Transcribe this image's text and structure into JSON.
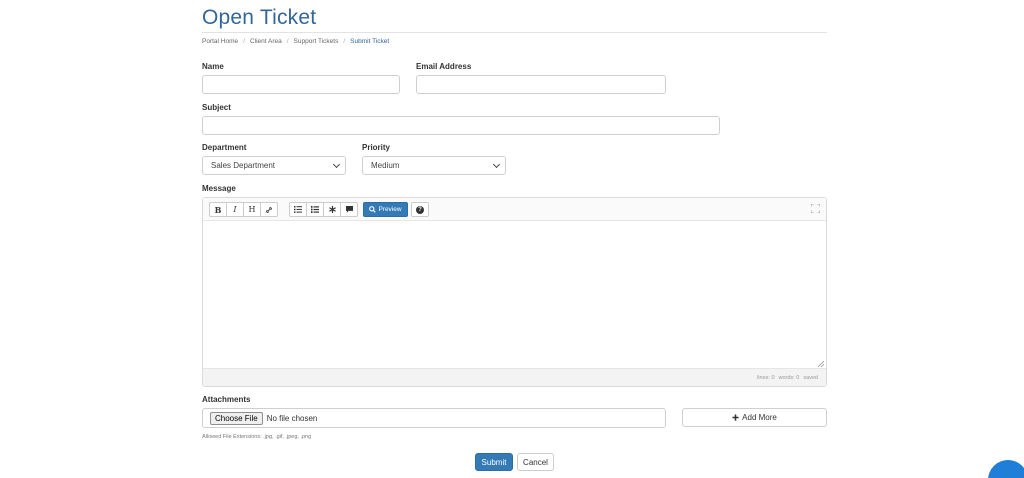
{
  "page": {
    "title": "Open Ticket"
  },
  "breadcrumb": {
    "items": [
      "Portal Home",
      "Client Area",
      "Support Tickets",
      "Submit Ticket"
    ],
    "separator": "/"
  },
  "form": {
    "name_label": "Name",
    "name_value": "",
    "email_label": "Email Address",
    "email_value": "",
    "subject_label": "Subject",
    "subject_value": "",
    "department_label": "Department",
    "department_value": "Sales Department",
    "priority_label": "Priority",
    "priority_value": "Medium",
    "message_label": "Message",
    "attachments_label": "Attachments"
  },
  "editor": {
    "toolbar": {
      "bold": "B",
      "italic": "I",
      "heading": "H",
      "preview_label": "Preview"
    },
    "status": {
      "lines": "lines: 0",
      "words": "words: 0",
      "saved": "saved"
    }
  },
  "attachments": {
    "choose_label": "Choose File",
    "no_file_text": "No file chosen",
    "add_more_label": "Add More",
    "allowed_text": "Allowed File Extensions: .jpg, .gif, .jpeg, .png"
  },
  "actions": {
    "submit_label": "Submit",
    "cancel_label": "Cancel"
  },
  "colors": {
    "brand": "#336699",
    "primary_button": "#337ab7",
    "chat_widget": "#1f7fd8"
  },
  "icons": {
    "link": "link-icon",
    "unordered_list": "unordered-list-icon",
    "ordered_list": "ordered-list-icon",
    "code": "code-icon",
    "quote": "quote-icon",
    "preview": "search-icon",
    "help": "question-circle-icon",
    "expand": "fullscreen-icon",
    "add_more": "plus-icon",
    "chat": "chat-icon"
  }
}
